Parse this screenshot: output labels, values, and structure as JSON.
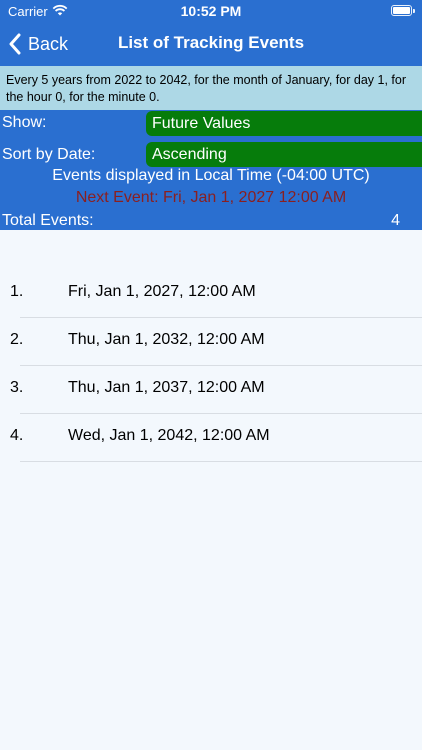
{
  "status_bar": {
    "carrier": "Carrier",
    "time": "10:52 PM"
  },
  "nav": {
    "back_label": "Back",
    "title": "List of Tracking Events"
  },
  "description": "Every 5 years from 2022 to 2042, for the month of January, for day 1, for the hour 0, for the minute 0.",
  "controls": {
    "show_label": "Show:",
    "show_value": "Future Values",
    "sort_label": "Sort by Date:",
    "sort_value": "Ascending",
    "timezone_note": "Events displayed in Local Time (-04:00 UTC)",
    "next_event": "Next Event: Fri, Jan 1, 2027 12:00 AM",
    "total_label": "Total Events:",
    "total_count": "4"
  },
  "events": [
    {
      "num": "1.",
      "date": "Fri, Jan 1, 2027, 12:00 AM"
    },
    {
      "num": "2.",
      "date": "Thu, Jan 1, 2032, 12:00 AM"
    },
    {
      "num": "3.",
      "date": "Thu, Jan 1, 2037, 12:00 AM"
    },
    {
      "num": "4.",
      "date": "Wed, Jan 1, 2042, 12:00 AM"
    }
  ],
  "colors": {
    "nav_blue": "#2a6fd0",
    "description_bg": "#add8e6",
    "selector_green": "#067c0b",
    "next_event_red": "#8b1f1f"
  }
}
